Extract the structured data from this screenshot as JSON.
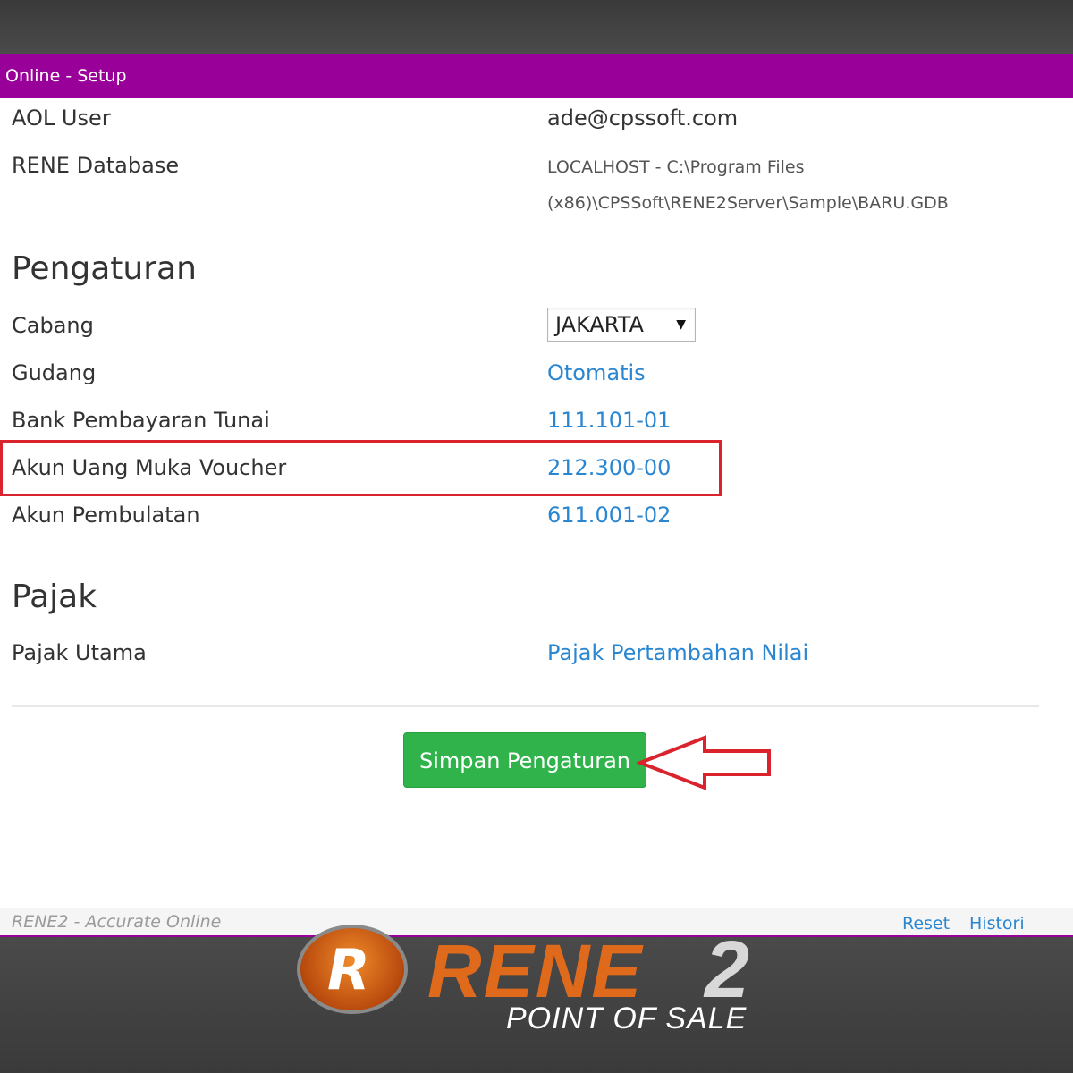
{
  "window": {
    "title": "Online - Setup"
  },
  "account": {
    "aol_user_label": "AOL User",
    "aol_user_value": "ade@cpssoft.com",
    "rene_db_label": "RENE Database",
    "rene_db_line1": "LOCALHOST - C:\\Program Files",
    "rene_db_line2": "(x86)\\CPSSoft\\RENE2Server\\Sample\\BARU.GDB"
  },
  "pengaturan": {
    "heading": "Pengaturan",
    "cabang_label": "Cabang",
    "cabang_value": "JAKARTA",
    "gudang_label": "Gudang",
    "gudang_value": "Otomatis",
    "bank_label": "Bank Pembayaran Tunai",
    "bank_value": "111.101-01",
    "voucher_label": "Akun Uang Muka Voucher",
    "voucher_value": "212.300-00",
    "pembulatan_label": "Akun Pembulatan",
    "pembulatan_value": "611.001-02"
  },
  "pajak": {
    "heading": "Pajak",
    "utama_label": "Pajak Utama",
    "utama_value": "Pajak Pertambahan Nilai"
  },
  "actions": {
    "save_label": "Simpan Pengaturan"
  },
  "footer": {
    "app_name": "RENE2 - Accurate Online",
    "reset_label": "Reset",
    "histori_label": "Histori"
  },
  "logo": {
    "letter": "R",
    "word": "RENE",
    "number": "2",
    "tagline": "POINT OF SALE"
  },
  "colors": {
    "titlebar": "#990099",
    "link": "#2a86d0",
    "save_button": "#2fb34a",
    "annotation": "#d9232d"
  },
  "icons": {
    "select_caret": "caret-down-icon",
    "annotation_arrow": "arrow-left-icon"
  }
}
